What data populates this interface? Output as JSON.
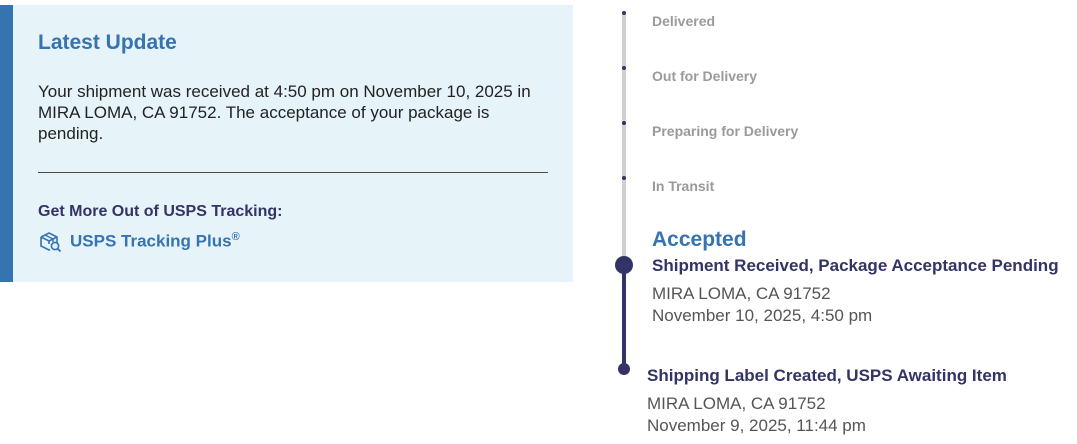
{
  "latest_update": {
    "title": "Latest Update",
    "message": "Your shipment was received at 4:50 pm on November 10, 2025 in MIRA LOMA, CA 91752. The acceptance of your package is pending.",
    "more_title": "Get More Out of USPS Tracking:",
    "tracking_plus_label": "USPS Tracking Plus",
    "tracking_plus_mark": "®",
    "tracking_plus_icon": "package-search-icon"
  },
  "timeline": {
    "steps": [
      "Delivered",
      "Out for Delivery",
      "Preparing for Delivery",
      "In Transit"
    ],
    "current_status": "Accepted",
    "events": [
      {
        "title": "Shipment Received, Package Acceptance Pending",
        "location": "MIRA LOMA, CA 91752",
        "datetime": "November 10, 2025, 4:50 pm"
      },
      {
        "title": "Shipping Label Created, USPS Awaiting Item",
        "location": "MIRA LOMA, CA 91752",
        "datetime": "November 9, 2025, 11:44 pm"
      }
    ]
  },
  "colors": {
    "accent_blue": "#3573b1",
    "navy": "#333366",
    "card_bg": "#e6f3f8"
  }
}
